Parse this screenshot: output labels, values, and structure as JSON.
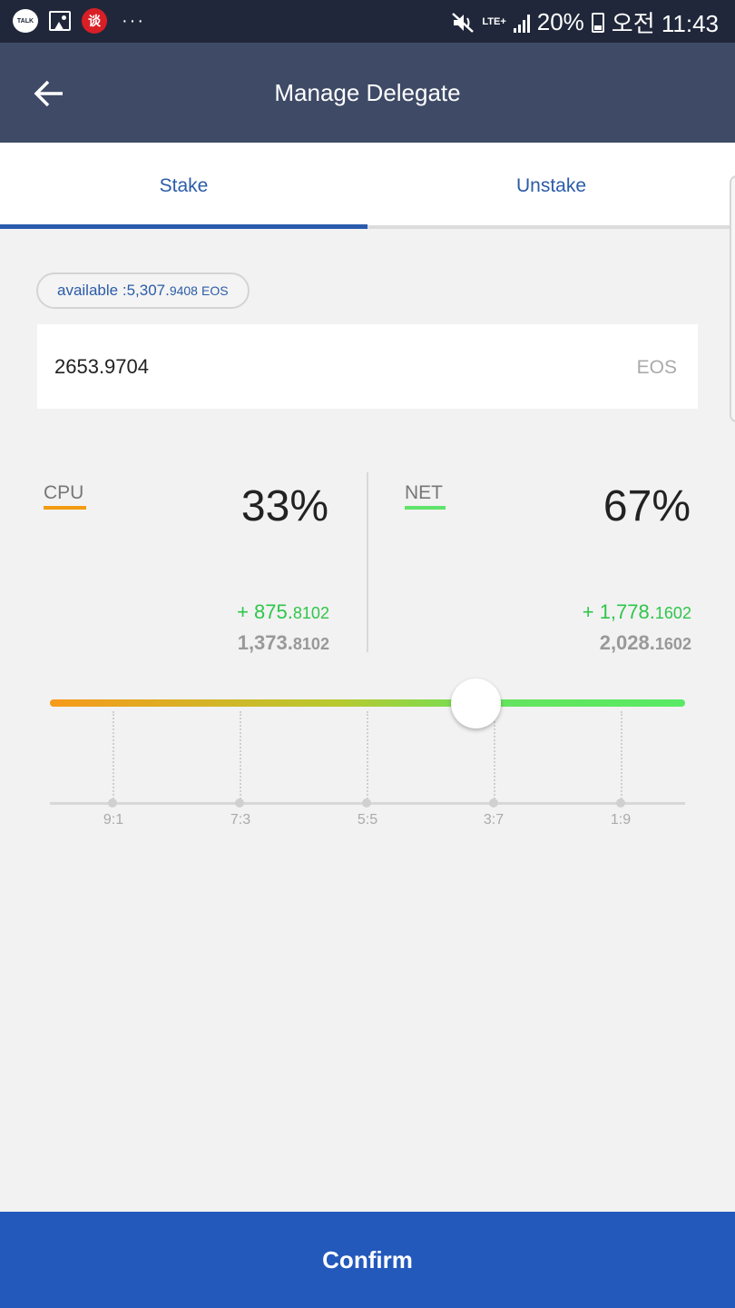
{
  "status_bar": {
    "talk_label": "TALK",
    "red_app_glyph": "谈",
    "more_dots": "···",
    "network": "LTE+",
    "battery": "20%",
    "time": "오전 11:43"
  },
  "header": {
    "title": "Manage Delegate",
    "back_icon": "arrow-left-icon"
  },
  "tabs": [
    {
      "label": "Stake",
      "active": true
    },
    {
      "label": "Unstake",
      "active": false
    }
  ],
  "available": {
    "prefix": "available : ",
    "whole": "5,307.",
    "decimal": "9408",
    "unit": "EOS"
  },
  "amount": {
    "value": "2653.9704",
    "unit": "EOS"
  },
  "cpu": {
    "label": "CPU",
    "percent": "33%",
    "add_whole": "+ 875.",
    "add_decimal": "8102",
    "total_whole": "1,373.",
    "total_decimal": "8102",
    "color": "#f39c12"
  },
  "net": {
    "label": "NET",
    "percent": "67%",
    "add_whole": "+ 1,778.",
    "add_decimal": "1602",
    "total_whole": "2,028.",
    "total_decimal": "1602",
    "color": "#5fe46b"
  },
  "slider": {
    "value_fraction": 0.67,
    "ticks": [
      "9:1",
      "7:3",
      "5:5",
      "3:7",
      "1:9"
    ]
  },
  "confirm_label": "Confirm",
  "colors": {
    "status_bar": "#20273a",
    "app_bar": "#3e4a66",
    "accent": "#2a5cae",
    "positive": "#2fc64a"
  }
}
